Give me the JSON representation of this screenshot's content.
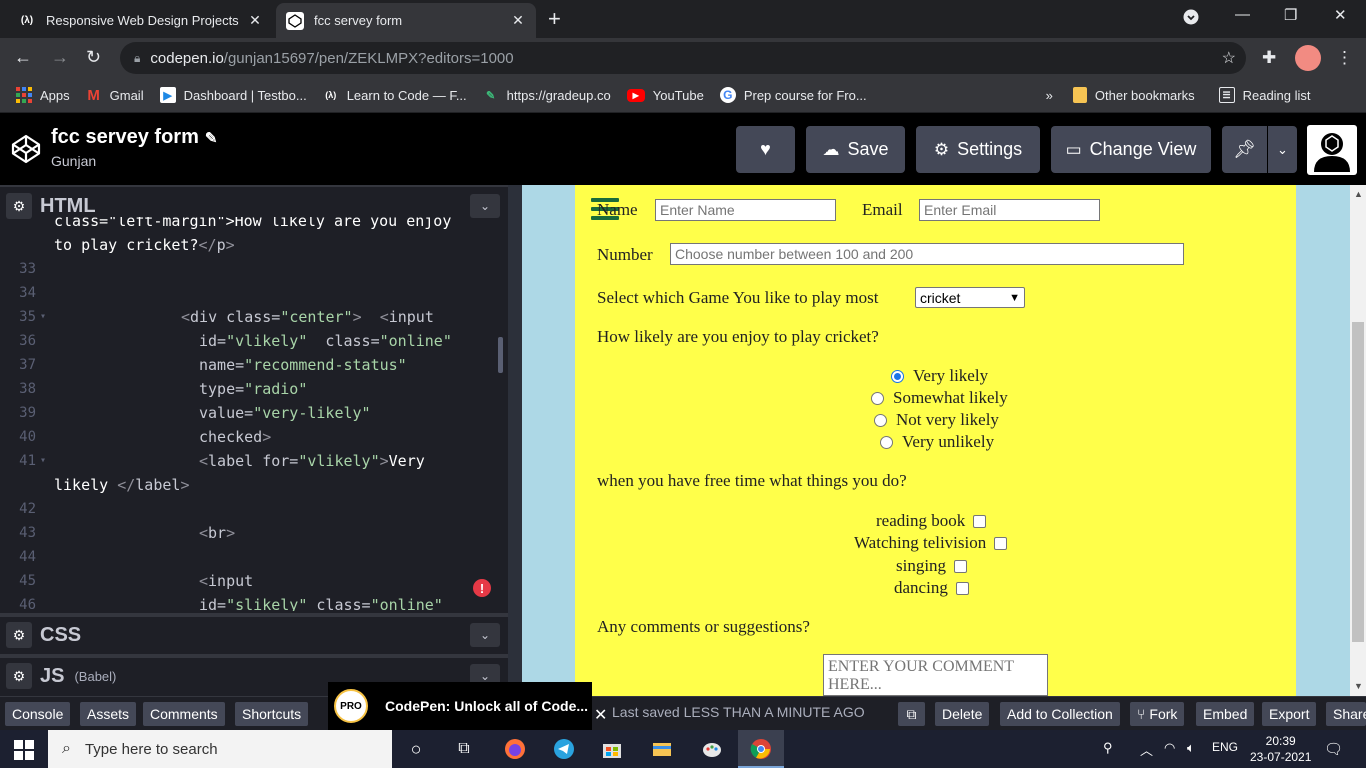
{
  "browser": {
    "tabs": [
      {
        "label": "Responsive Web Design Projects",
        "icon": "freecodecamp-icon",
        "active": false
      },
      {
        "label": "fcc servey form",
        "icon": "codepen-icon",
        "active": true
      }
    ],
    "url_host": "codepen.io",
    "url_path": "/gunjan15697/pen/ZEKLMPX?editors=1000",
    "bookmarks": [
      {
        "label": "Apps",
        "icon": "apps-grid-icon"
      },
      {
        "label": "Gmail",
        "icon": "gmail-icon"
      },
      {
        "label": "Dashboard | Testbo...",
        "icon": "testbook-icon"
      },
      {
        "label": "Learn to Code — F...",
        "icon": "freecodecamp-icon"
      },
      {
        "label": "https://gradeup.co",
        "icon": "gradeup-icon"
      },
      {
        "label": "YouTube",
        "icon": "youtube-icon"
      },
      {
        "label": "Prep course for Fro...",
        "icon": "google-icon"
      }
    ],
    "bookmarks_overflow": "»",
    "other_bookmarks": "Other bookmarks",
    "reading_list": "Reading list"
  },
  "codepen": {
    "pen_title": "fcc servey form",
    "author": "Gunjan",
    "buttons": {
      "save": "Save",
      "settings": "Settings",
      "change_view": "Change View"
    },
    "panels": {
      "html": "HTML",
      "css": "CSS",
      "js": "JS",
      "js_sub": "(Babel)"
    },
    "code_lines": [
      {
        "n": "",
        "segments": [
          [
            "t-txt",
            "class=\"left-margin\">How likely are you enjoy"
          ]
        ],
        "indent": 54
      },
      {
        "n": "",
        "segments": [
          [
            "t-txt",
            "to play cricket?"
          ],
          [
            "t-tag",
            "</"
          ],
          [
            "t-name",
            "p"
          ],
          [
            "t-tag",
            ">"
          ]
        ],
        "indent": 54
      },
      {
        "n": "33",
        "segments": [],
        "indent": 54
      },
      {
        "n": "34",
        "segments": [],
        "indent": 54
      },
      {
        "n": "35",
        "fold": true,
        "segments": [
          [
            "t-tag",
            "<"
          ],
          [
            "t-name",
            "div"
          ],
          [
            "t-attr",
            " class="
          ],
          [
            "t-str",
            "\"center\""
          ],
          [
            "t-tag",
            ">"
          ],
          [
            "t-txt",
            "  "
          ],
          [
            "t-tag",
            "<"
          ],
          [
            "t-name",
            "input"
          ]
        ],
        "indent": 181
      },
      {
        "n": "36",
        "segments": [
          [
            "t-attr",
            "id="
          ],
          [
            "t-str",
            "\"vlikely\""
          ],
          [
            "t-attr",
            "  class="
          ],
          [
            "t-str",
            "\"online\""
          ]
        ],
        "indent": 199
      },
      {
        "n": "37",
        "segments": [
          [
            "t-attr",
            "name="
          ],
          [
            "t-str",
            "\"recommend-status\""
          ]
        ],
        "indent": 199
      },
      {
        "n": "38",
        "segments": [
          [
            "t-attr",
            "type="
          ],
          [
            "t-str",
            "\"radio\""
          ]
        ],
        "indent": 199
      },
      {
        "n": "39",
        "segments": [
          [
            "t-attr",
            "value="
          ],
          [
            "t-str",
            "\"very-likely\""
          ]
        ],
        "indent": 199
      },
      {
        "n": "40",
        "segments": [
          [
            "t-attr",
            "checked"
          ],
          [
            "t-tag",
            ">"
          ]
        ],
        "indent": 199
      },
      {
        "n": "41",
        "fold": true,
        "segments": [
          [
            "t-tag",
            "<"
          ],
          [
            "t-name",
            "label"
          ],
          [
            "t-attr",
            " for="
          ],
          [
            "t-str",
            "\"vlikely\""
          ],
          [
            "t-tag",
            ">"
          ],
          [
            "t-txt",
            "Very"
          ]
        ],
        "indent": 199
      },
      {
        "n": "",
        "segments": [
          [
            "t-txt",
            "likely "
          ],
          [
            "t-tag",
            "</"
          ],
          [
            "t-name",
            "label"
          ],
          [
            "t-tag",
            ">"
          ]
        ],
        "indent": 54
      },
      {
        "n": "42",
        "segments": [],
        "indent": 54
      },
      {
        "n": "43",
        "segments": [
          [
            "t-tag",
            "<"
          ],
          [
            "t-name",
            "br"
          ],
          [
            "t-tag",
            ">"
          ]
        ],
        "indent": 199
      },
      {
        "n": "44",
        "segments": [],
        "indent": 54
      },
      {
        "n": "45",
        "segments": [
          [
            "t-tag",
            "<"
          ],
          [
            "t-name",
            "input"
          ]
        ],
        "indent": 199
      },
      {
        "n": "46",
        "segments": [
          [
            "t-attr",
            "id="
          ],
          [
            "t-str",
            "\"slikely\""
          ],
          [
            "t-attr",
            " class="
          ],
          [
            "t-str",
            "\"online\""
          ]
        ],
        "indent": 199
      }
    ],
    "bottom_buttons": {
      "console": "Console",
      "assets": "Assets",
      "comments": "Comments",
      "shortcuts": "Shortcuts",
      "delete": "Delete",
      "add_collection": "Add to Collection",
      "fork": "Fork",
      "embed": "Embed",
      "export": "Export",
      "share": "Share"
    },
    "promo_badge": "PRO",
    "promo_text": "CodePen: Unlock all of Code...",
    "last_saved": "Last saved LESS THAN A MINUTE AGO"
  },
  "form": {
    "name_label": "Name",
    "name_placeholder": "Enter Name",
    "email_label": "Email",
    "email_placeholder": "Enter Email",
    "number_label": "Number",
    "number_placeholder": "Choose  number between 100 and 200",
    "game_label": "Select which Game You like to play most",
    "game_selected": "cricket",
    "likely_question": "How likely are you enjoy to play cricket?",
    "radios": [
      {
        "label": "Very likely",
        "checked": true
      },
      {
        "label": "Somewhat likely",
        "checked": false
      },
      {
        "label": "Not very likely",
        "checked": false
      },
      {
        "label": "Very unlikely",
        "checked": false
      }
    ],
    "freetime_question": "when you have free time what things you do?",
    "checkboxes": [
      {
        "label": "reading book"
      },
      {
        "label": "Watching telivision"
      },
      {
        "label": "singing"
      },
      {
        "label": "dancing"
      }
    ],
    "comments_question": "Any comments or suggestions?",
    "comment_placeholder": "ENTER YOUR COMMENT HERE..."
  },
  "taskbar": {
    "search_placeholder": "Type here to search",
    "language": "ENG",
    "time": "20:39",
    "date": "23-07-2021"
  }
}
